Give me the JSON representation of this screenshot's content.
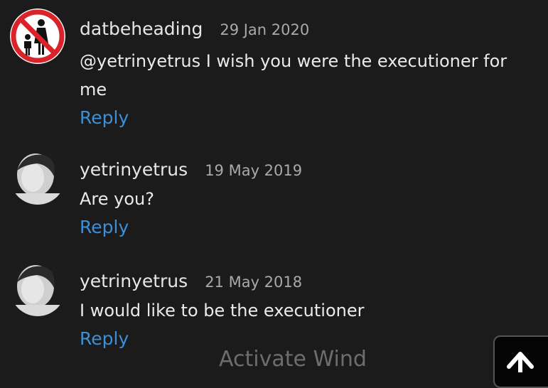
{
  "comments": [
    {
      "username": "datbeheading",
      "date": "29 Jan 2020",
      "text": "@yetrinyetrus I wish you were the executioner for me",
      "reply_label": "Reply",
      "avatar_icon": "no-children-sign-icon"
    },
    {
      "username": "yetrinyetrus",
      "date": "19 May 2019",
      "text": "Are you?",
      "reply_label": "Reply",
      "avatar_icon": "profile-photo"
    },
    {
      "username": "yetrinyetrus",
      "date": "21 May 2018",
      "text": "I would like to be the executioner",
      "reply_label": "Reply",
      "avatar_icon": "profile-photo"
    }
  ],
  "watermark": "Activate Wind",
  "scroll_top_icon": "arrow-up-icon",
  "colors": {
    "background": "#1b1b1c",
    "reply_link": "#3d8fd6",
    "date": "#a9a9a9"
  }
}
